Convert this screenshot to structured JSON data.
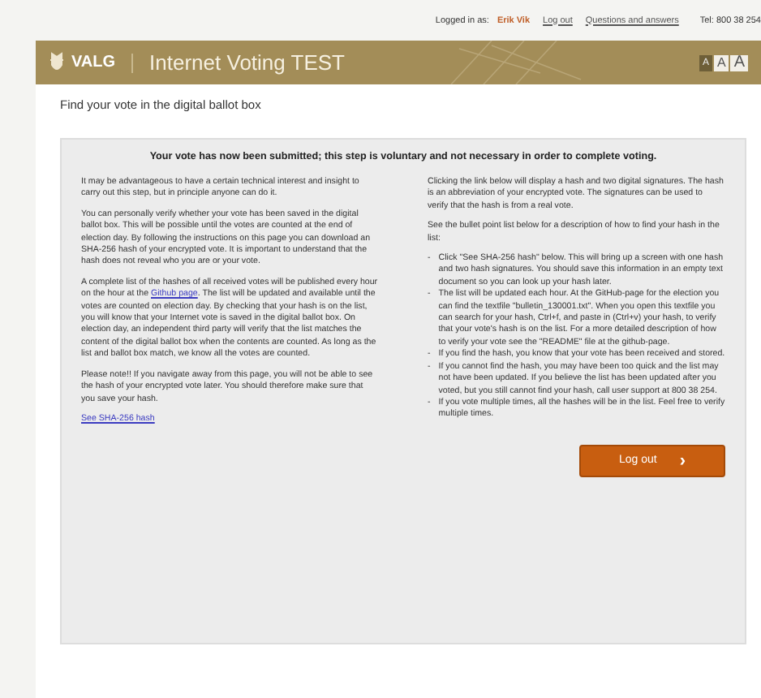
{
  "top_bar": {
    "logged_in_label": "Logged in as:",
    "user_name": "Erik Vik",
    "links": [
      "Log out",
      "Questions and answers"
    ],
    "phone": "Tel: 800 38 254"
  },
  "header": {
    "logo_text": "VALG",
    "title": "Internet Voting TEST",
    "font_sizes": [
      {
        "label": "A",
        "selected": true
      },
      {
        "label": "A",
        "selected": false
      },
      {
        "label": "A",
        "selected": false
      }
    ]
  },
  "page_title": "Find your vote in the digital ballot box",
  "notice": {
    "heading": "Your vote has now been submitted; this step is voluntary and not necessary in order to complete voting.",
    "left_paragraphs": [
      {
        "kind": "text",
        "text": "It may be advantageous to have a certain technical interest and insight to carry out this step, but in principle anyone can do it."
      },
      {
        "kind": "text",
        "text": "You can personally verify whether your vote has been saved in the digital ballot box. This will be possible until the votes are counted at the end of election day. By following the instructions on this page you can download an SHA-256 hash of your encrypted vote. It is important to understand that the hash does not reveal who you are or your vote."
      },
      {
        "kind": "linked",
        "before": "A complete list of the hashes of all received votes will be published every hour on the hour at the",
        "link": "Github page",
        "after": ". The list will be updated and available until the votes are counted on election day. By checking that your hash is on the list, you will know that your Internet vote is saved in the digital ballot box. On election day, an independent third party will verify that the list matches the content of the digital ballot box when the contents are counted. As long as the list and ballot box match, we know all the votes are counted."
      },
      {
        "kind": "text",
        "text": "Please note!! If you navigate away from this page, you will not be able to see the hash of your encrypted vote later. You should therefore make sure that you save your hash."
      },
      {
        "kind": "link",
        "text": "See SHA-256 hash"
      }
    ],
    "right_paragraphs": [
      "Clicking the link below will display a hash and two digital signatures. The hash is an abbreviation of your encrypted vote. The signatures can be used to verify that the hash is from a real vote.",
      "See the bullet point list below for a description of how to find your hash in the list:"
    ],
    "bullets": [
      "Click \"See SHA-256 hash\" below. This will bring up a screen with one hash and two hash signatures. You should save this information in an empty text document so you can look up your hash later.",
      "The list will be updated each hour. At the GitHub-page for the election you can find the textfile \"bulletin_130001.txt\". When you open this textfile you can search for your hash, Ctrl+f, and paste in (Ctrl+v) your hash, to verify that your vote's hash is on the list. For a more detailed description of how to verify your vote see the \"README\" file at the github-page.",
      "If you find the hash, you know that your vote has been received and stored.",
      "If you cannot find the hash, you may have been too quick and the list may not have been updated. If you believe the list has been updated after you voted, but you still cannot find your hash, call user support at 800 38 254.",
      "If you vote multiple times, all the hashes will be in the list. Feel free to verify multiple times."
    ],
    "bullet_marker": "-",
    "logout_button": {
      "label": "Log out",
      "icon": "›"
    }
  }
}
